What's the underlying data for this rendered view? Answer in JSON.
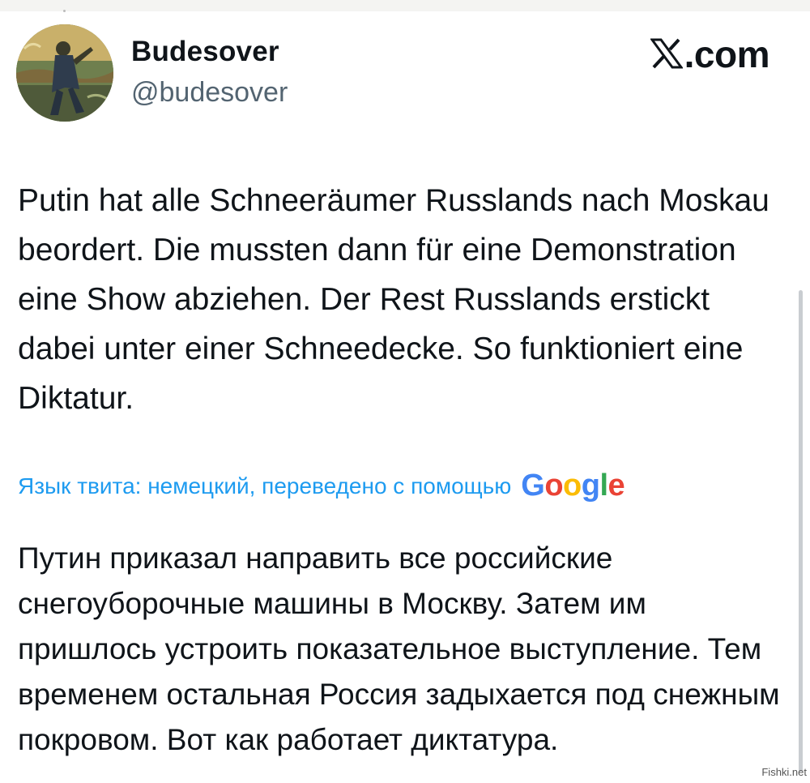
{
  "author": {
    "display_name": "Budesover",
    "handle": "@budesover"
  },
  "brand": {
    "source_label": ".com",
    "x_glyph": "x-logo-icon"
  },
  "tweet": {
    "text": "Putin hat alle Schneeräumer Russlands nach Moskau beordert. Die mussten dann für eine Demonstration eine Show abziehen. Der Rest Russlands erstickt dabei unter einer Schneedecke. So funktioniert eine Diktatur."
  },
  "translation": {
    "label": "Язык твита: немецкий, переведено с помощью",
    "provider_letters": [
      "G",
      "o",
      "o",
      "g",
      "l",
      "e"
    ],
    "provider_colors": [
      "#4285f4",
      "#ea4335",
      "#fbbc05",
      "#4285f4",
      "#34a853",
      "#ea4335"
    ],
    "text": "Путин приказал направить все российские снегоуборочные машины в Москву. Затем им пришлось устроить показательное выступление. Тем временем остальная Россия задыхается под снежным покровом. Вот как работает диктатура."
  },
  "watermark": "Fishki.net",
  "colors": {
    "text": "#0f1419",
    "secondary": "#536471",
    "link": "#1d9bf0"
  }
}
